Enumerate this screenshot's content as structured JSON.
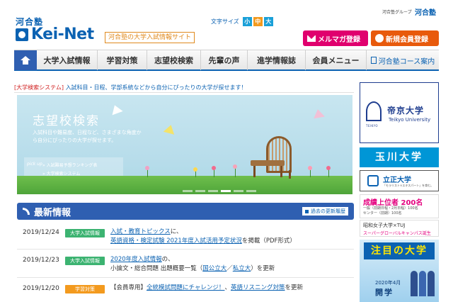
{
  "header": {
    "logo_kawai": "河合塾",
    "logo_text": "Kei-Net",
    "tagline": "河合塾の大学入試情報サイト",
    "font_size_label": "文字サイズ",
    "font_size_small": "小",
    "font_size_medium": "中",
    "font_size_large": "大",
    "group_label": "河合塾グループ",
    "group_logo": "河合塾",
    "mail_button": "メルマガ登録",
    "register_button": "新規会員登録"
  },
  "nav": {
    "items": [
      "大学入試情報",
      "学習対策",
      "志望校検索",
      "先輩の声",
      "進学情報誌",
      "会員メニュー"
    ],
    "course_guide": "河合塾コース案内"
  },
  "promo": {
    "tag": "[大学検索システム]",
    "text": "入試科目・日程、学部系統などから自分にぴったりの大学が探せます！"
  },
  "banner": {
    "title": "志望校検索",
    "description": "入試科目や難易度、日程など、さまざまな角度から自分にぴったりの大学が探せます。",
    "pickup": "pick up",
    "link1": "» 入試難易予想ランキング表",
    "link2": "» 大学検索システム"
  },
  "news": {
    "title": "最新情報",
    "past_link": "過去の更新履歴",
    "rows": [
      {
        "date": "2019/12/24",
        "category": "大学入試情報",
        "p1": "入試・教育トピックス",
        "p2": "に、",
        "p3": "英語資格・検定試験 2021年度入試活用予定状況",
        "p4": "を掲載（PDF形式）"
      },
      {
        "date": "2019/12/23",
        "category": "大学入試情報",
        "p1": "2020年度入試情報",
        "p2": "の、",
        "p3": "小論文・総合問題 出題概要一覧（",
        "p4": "国公立大",
        "p5": "／",
        "p6": "私立大",
        "p7": "）を更新"
      },
      {
        "date": "2019/12/20",
        "category": "学習対策",
        "p1": "【会員専用】",
        "p2": "全統模試問題にチャレンジ！",
        "p3": "、",
        "p4": "英語リスニング対策",
        "p5": "を更新"
      }
    ]
  },
  "sidebar": {
    "teikyo_mark": "TEIKYO",
    "teikyo_jp": "帝京大学",
    "teikyo_en": "Teikyo University",
    "tamagawa": "玉川大学",
    "rissho_name": "立正大学",
    "rissho_sub": "「モラリスト×エキスパート」を育む。",
    "score_line1": "成績上位者 200名",
    "score_line2a": "一般（前期日程・2月日程）100名",
    "score_line2b": "センター（前期）100名",
    "showa_line1": "昭和女子大学×TUJ",
    "showa_line2": "スーパーグローバルキャンパス誕生",
    "chumoku_title": "注目の大学",
    "chumoku_sub1": "2020年4月",
    "chumoku_sub2": "開学"
  },
  "colors": {
    "brand_blue": "#0b62b2",
    "nav_home": "#2f5fb1",
    "mail_pink": "#e0006e",
    "register_orange": "#e85a0c",
    "cat_green": "#3cb371",
    "cat_orange": "#f39a1e",
    "font_small": "#1aa0d8",
    "font_medium": "#f39a1e",
    "font_large": "#1aa0d8"
  }
}
